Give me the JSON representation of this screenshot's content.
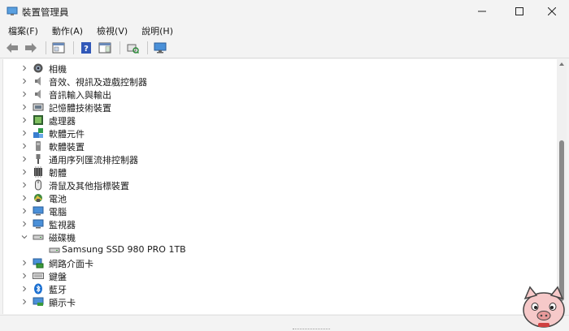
{
  "window": {
    "title": "裝置管理員",
    "minimize_icon": "minimize-icon",
    "maximize_icon": "maximize-icon",
    "close_icon": "close-icon"
  },
  "menu": [
    {
      "label": "檔案(F)"
    },
    {
      "label": "動作(A)"
    },
    {
      "label": "檢視(V)"
    },
    {
      "label": "說明(H)"
    }
  ],
  "toolbar": [
    "back-arrow-icon",
    "forward-arrow-icon",
    "properties-icon",
    "help-icon",
    "action-pane-icon",
    "scan-hardware-icon",
    "monitor-icon"
  ],
  "tree": {
    "categories": [
      {
        "label": "相機",
        "icon": "camera-icon",
        "expanded": false
      },
      {
        "label": "音效、視訊及遊戲控制器",
        "icon": "speaker-icon",
        "expanded": false
      },
      {
        "label": "音訊輸入與輸出",
        "icon": "speaker-icon",
        "expanded": false
      },
      {
        "label": "記憶體技術裝置",
        "icon": "memory-icon",
        "expanded": false
      },
      {
        "label": "處理器",
        "icon": "processor-icon",
        "expanded": false
      },
      {
        "label": "軟體元件",
        "icon": "software-component-icon",
        "expanded": false
      },
      {
        "label": "軟體裝置",
        "icon": "software-device-icon",
        "expanded": false
      },
      {
        "label": "通用序列匯流排控制器",
        "icon": "usb-icon",
        "expanded": false
      },
      {
        "label": "韌體",
        "icon": "firmware-icon",
        "expanded": false
      },
      {
        "label": "滑鼠及其他指標裝置",
        "icon": "mouse-icon",
        "expanded": false
      },
      {
        "label": "電池",
        "icon": "battery-icon",
        "expanded": false
      },
      {
        "label": "電腦",
        "icon": "computer-icon",
        "expanded": false
      },
      {
        "label": "監視器",
        "icon": "monitor-icon",
        "expanded": false
      },
      {
        "label": "磁碟機",
        "icon": "disk-drive-icon",
        "expanded": true
      },
      {
        "label": "網路介面卡",
        "icon": "network-adapter-icon",
        "expanded": false
      },
      {
        "label": "鍵盤",
        "icon": "keyboard-icon",
        "expanded": false
      },
      {
        "label": "藍牙",
        "icon": "bluetooth-icon",
        "expanded": false
      },
      {
        "label": "顯示卡",
        "icon": "display-adapter-icon",
        "expanded": false
      }
    ],
    "disk_child": {
      "label": "Samsung SSD 980 PRO 1TB",
      "icon": "disk-icon"
    }
  },
  "colors": {
    "accent": "#1a6fd1",
    "window_bg": "#f3f3f3",
    "tree_bg": "#ffffff"
  }
}
